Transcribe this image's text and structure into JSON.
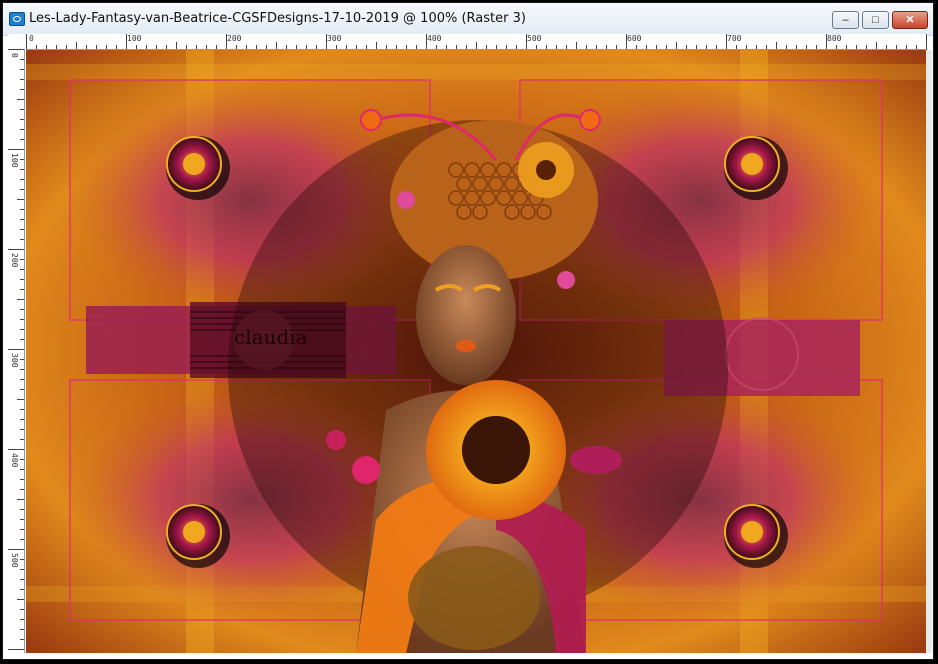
{
  "window": {
    "title": "Les-Lady-Fantasy-van-Beatrice-CGSFDesigns-17-10-2019 @ 100% (Raster 3)",
    "controls": {
      "minimize": "–",
      "maximize": "□",
      "close": "✕"
    }
  },
  "ruler": {
    "horizontal_labels": [
      "0",
      "100",
      "200",
      "300",
      "400",
      "500",
      "600",
      "700",
      "800"
    ],
    "vertical_labels": [
      "0",
      "100",
      "200",
      "300",
      "400",
      "500"
    ]
  },
  "canvas": {
    "watermark": "claudia",
    "colors": {
      "background": "#8a3a10",
      "orange": "#e07a14",
      "magenta": "#b0245a",
      "gold": "#f0a820",
      "dark": "#2a0a06"
    },
    "icons": [
      "mandala-ornament-icon",
      "portrait-image",
      "sunflower-icon",
      "watermark-logo"
    ]
  }
}
